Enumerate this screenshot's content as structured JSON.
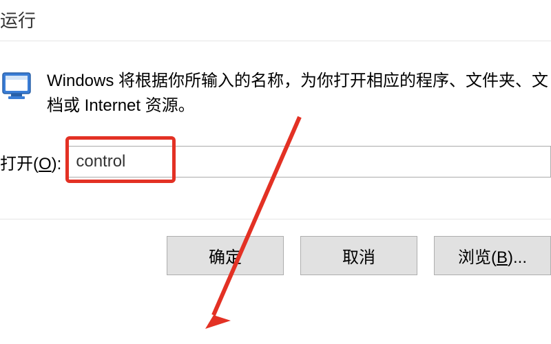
{
  "dialog": {
    "title": "运行",
    "description": "Windows 将根据你所输入的名称，为你打开相应的程序、文件夹、文档或 Internet 资源。",
    "input_label_prefix": "打开(",
    "input_label_key": "O",
    "input_label_suffix": "):",
    "input_value": "control",
    "buttons": {
      "ok": "确定",
      "cancel": "取消",
      "browse_prefix": "浏览(",
      "browse_key": "B",
      "browse_suffix": ")..."
    }
  }
}
